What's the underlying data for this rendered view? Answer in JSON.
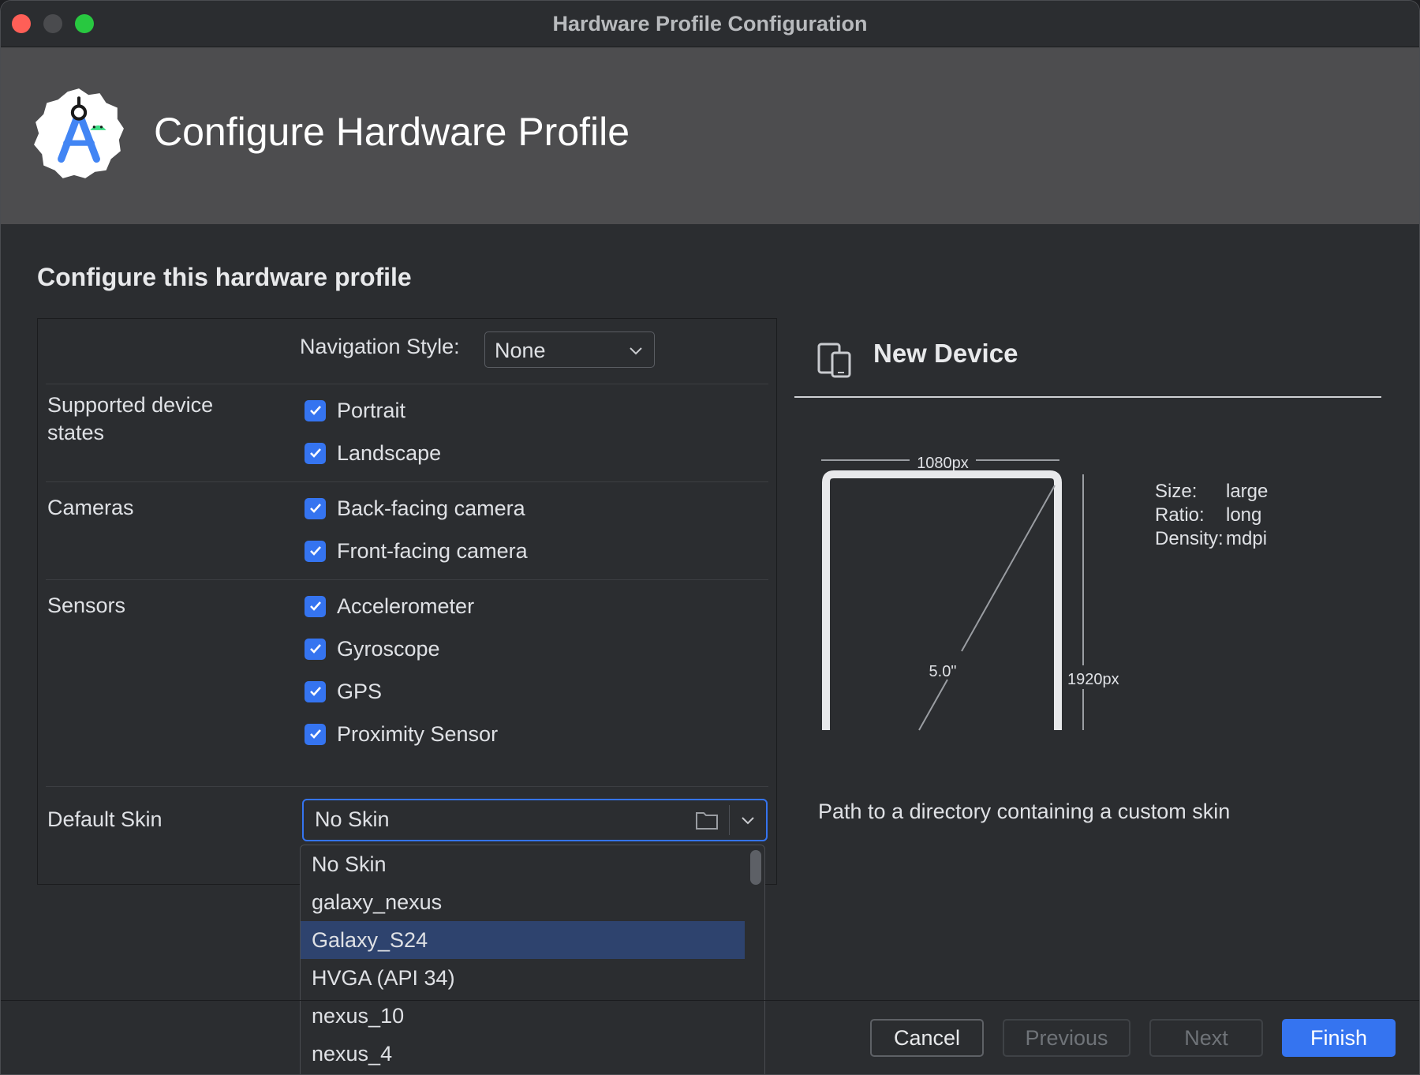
{
  "window": {
    "title": "Hardware Profile Configuration"
  },
  "banner": {
    "title": "Configure Hardware Profile",
    "logo_icon": "android-studio-icon"
  },
  "section": {
    "title": "Configure this hardware profile"
  },
  "form": {
    "navigation_style": {
      "label": "Navigation Style:",
      "value": "None"
    },
    "device_states": {
      "label": "Supported device states",
      "options": [
        {
          "label": "Portrait",
          "checked": true
        },
        {
          "label": "Landscape",
          "checked": true
        }
      ]
    },
    "cameras": {
      "label": "Cameras",
      "options": [
        {
          "label": "Back-facing camera",
          "checked": true
        },
        {
          "label": "Front-facing camera",
          "checked": true
        }
      ]
    },
    "sensors": {
      "label": "Sensors",
      "options": [
        {
          "label": "Accelerometer",
          "checked": true
        },
        {
          "label": "Gyroscope",
          "checked": true
        },
        {
          "label": "GPS",
          "checked": true
        },
        {
          "label": "Proximity Sensor",
          "checked": true
        }
      ]
    },
    "default_skin": {
      "label": "Default Skin",
      "value": "No Skin",
      "options": [
        "No Skin",
        "galaxy_nexus",
        "Galaxy_S24",
        "HVGA (API 34)",
        "nexus_10",
        "nexus_4"
      ],
      "highlighted": "Galaxy_S24"
    }
  },
  "preview": {
    "title": "New Device",
    "icon": "device-icon",
    "width_label": "1080px",
    "height_label": "1920px",
    "diagonal_label": "5.0\"",
    "specs": [
      {
        "key": "Size:",
        "value": "large"
      },
      {
        "key": "Ratio:",
        "value": "long"
      },
      {
        "key": "Density:",
        "value": "mdpi"
      }
    ],
    "help_text": "Path to a directory containing a custom skin"
  },
  "footer": {
    "cancel": "Cancel",
    "previous": "Previous",
    "next": "Next",
    "finish": "Finish"
  },
  "colors": {
    "accent": "#3574f0",
    "background": "#2b2d30",
    "banner": "#4d4d4f",
    "selection": "#2e436e"
  }
}
